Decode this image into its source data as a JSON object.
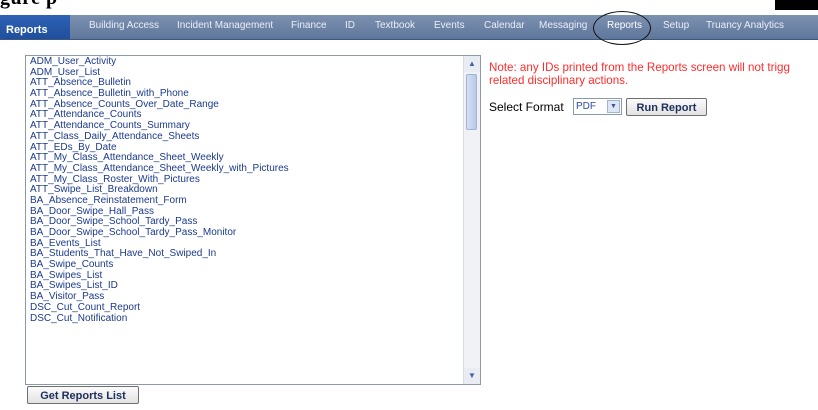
{
  "caption": {
    "text": "gure  p"
  },
  "nav": {
    "title": "Reports",
    "items": [
      "Building Access",
      "Incident Management",
      "Finance",
      "ID",
      "Textbook",
      "Events",
      "Calendar",
      "Messaging",
      "Reports",
      "Setup",
      "Truancy Analytics"
    ]
  },
  "reports": [
    "ADM_User_Activity",
    "ADM_User_List",
    "ATT_Absence_Bulletin",
    "ATT_Absence_Bulletin_with_Phone",
    "ATT_Absence_Counts_Over_Date_Range",
    "ATT_Attendance_Counts",
    "ATT_Attendance_Counts_Summary",
    "ATT_Class_Daily_Attendance_Sheets",
    "ATT_EDs_By_Date",
    "ATT_My_Class_Attendance_Sheet_Weekly",
    "ATT_My_Class_Attendance_Sheet_Weekly_with_Pictures",
    "ATT_My_Class_Roster_With_Pictures",
    "ATT_Swipe_List_Breakdown",
    "BA_Absence_Reinstatement_Form",
    "BA_Door_Swipe_Hall_Pass",
    "BA_Door_Swipe_School_Tardy_Pass",
    "BA_Door_Swipe_School_Tardy_Pass_Monitor",
    "BA_Events_List",
    "BA_Students_That_Have_Not_Swiped_In",
    "BA_Swipe_Counts",
    "BA_Swipes_List",
    "BA_Swipes_List_ID",
    "BA_Visitor_Pass",
    "DSC_Cut_Count_Report",
    "DSC_Cut_Notification"
  ],
  "note": {
    "line1": "Note: any IDs printed from the Reports screen will not trigg",
    "line2": "related disciplinary actions."
  },
  "format": {
    "label": "Select Format",
    "value": "PDF"
  },
  "buttons": {
    "run_report": "Run Report",
    "get_reports_list": "Get Reports List"
  }
}
